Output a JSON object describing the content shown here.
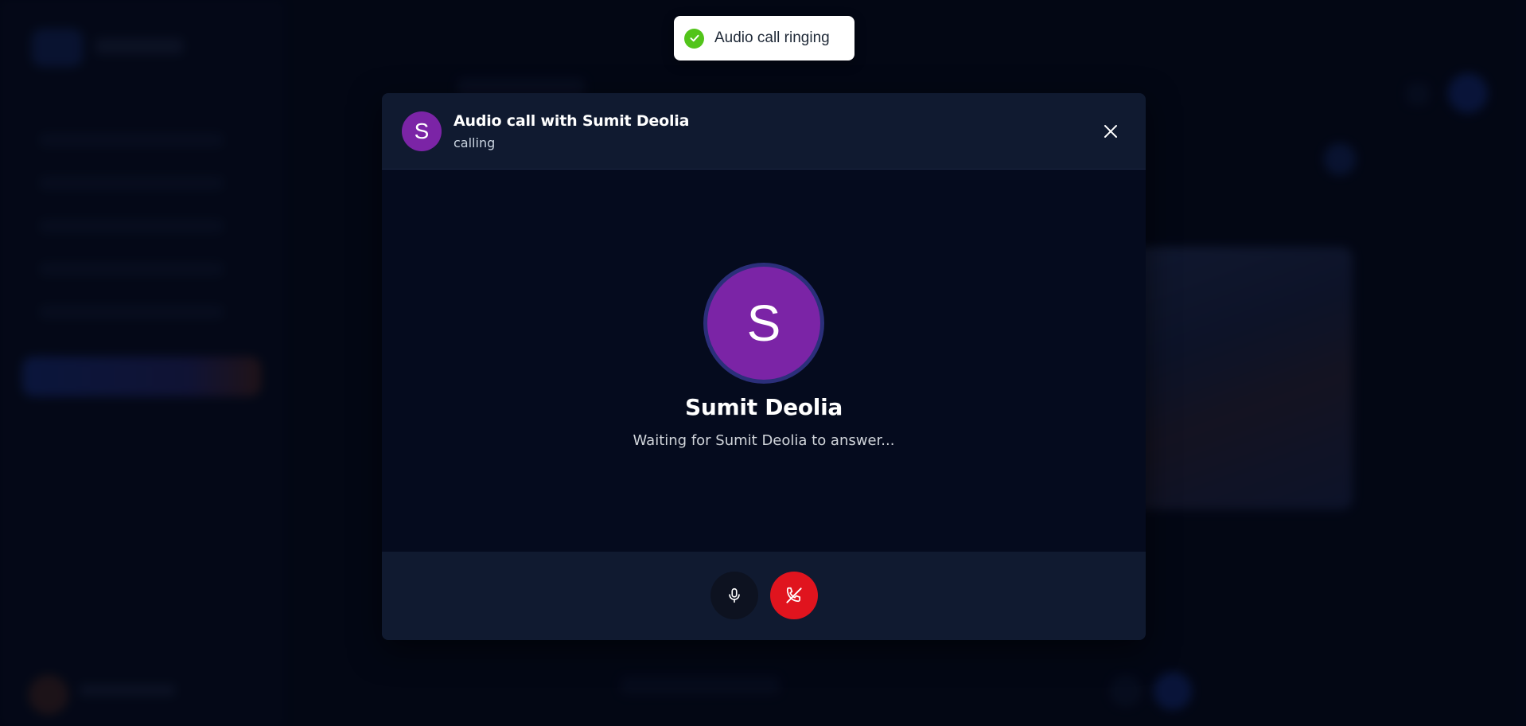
{
  "toast": {
    "icon": "check-circle-icon",
    "message": "Audio call ringing",
    "color": "#52c41a"
  },
  "dialog": {
    "header": {
      "avatar_initial": "S",
      "title": "Audio call with Sumit Deolia",
      "status": "calling",
      "close_icon": "close-icon"
    },
    "callee": {
      "avatar_initial": "S",
      "name": "Sumit Deolia",
      "waiting_text": "Waiting for Sumit Deolia to answer..."
    },
    "controls": {
      "mic_icon": "microphone-icon",
      "end_call_icon": "phone-hangup-icon"
    }
  },
  "colors": {
    "avatar": "#7b24a6",
    "end_call": "#e0141e",
    "dialog_bg": "#050b1e",
    "header_bg": "#101a30"
  }
}
